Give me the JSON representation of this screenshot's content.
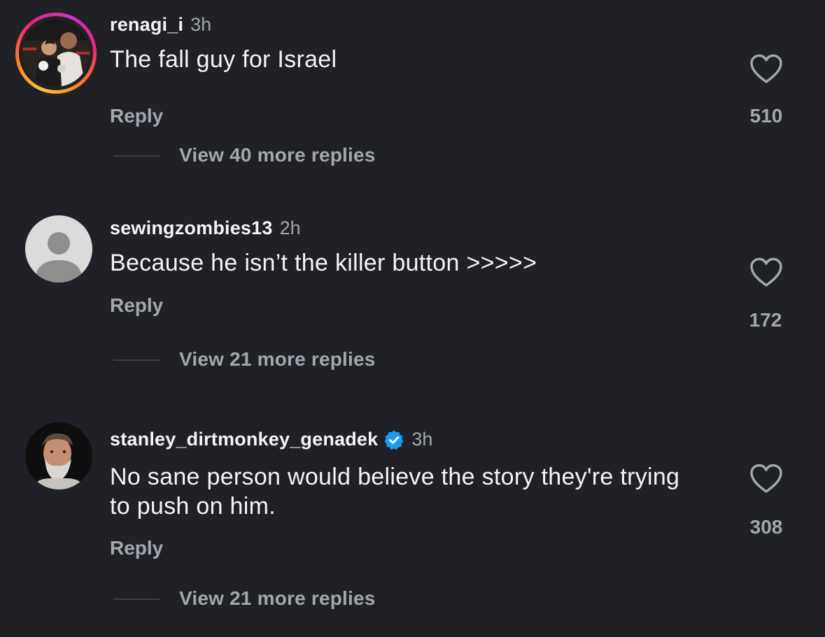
{
  "comments": [
    {
      "username": "renagi_i",
      "time": "3h",
      "text": "The fall guy for Israel",
      "reply_label": "Reply",
      "likes": "510",
      "view_more": "View 40 more replies",
      "verified": false,
      "avatar_ring": true
    },
    {
      "username": "sewingzombies13",
      "time": "2h",
      "text": "Because he isn’t the killer button >>>>>",
      "reply_label": "Reply",
      "likes": "172",
      "view_more": "View 21 more replies",
      "verified": false,
      "avatar_ring": false
    },
    {
      "username": "stanley_dirtmonkey_genadek",
      "time": "3h",
      "text": "No sane person would believe the story they're trying to push on him.",
      "reply_label": "Reply",
      "likes": "308",
      "view_more": "View 21 more replies",
      "verified": true,
      "avatar_ring": false
    }
  ],
  "colors": {
    "background": "#202126",
    "primary_text": "#f4f4f5",
    "secondary_text": "#a3a6ad",
    "verified_blue": "#1d9bf0"
  },
  "icons": {
    "like": "heart-icon",
    "verified": "verified-badge-icon",
    "default_avatar": "default-avatar-icon"
  }
}
